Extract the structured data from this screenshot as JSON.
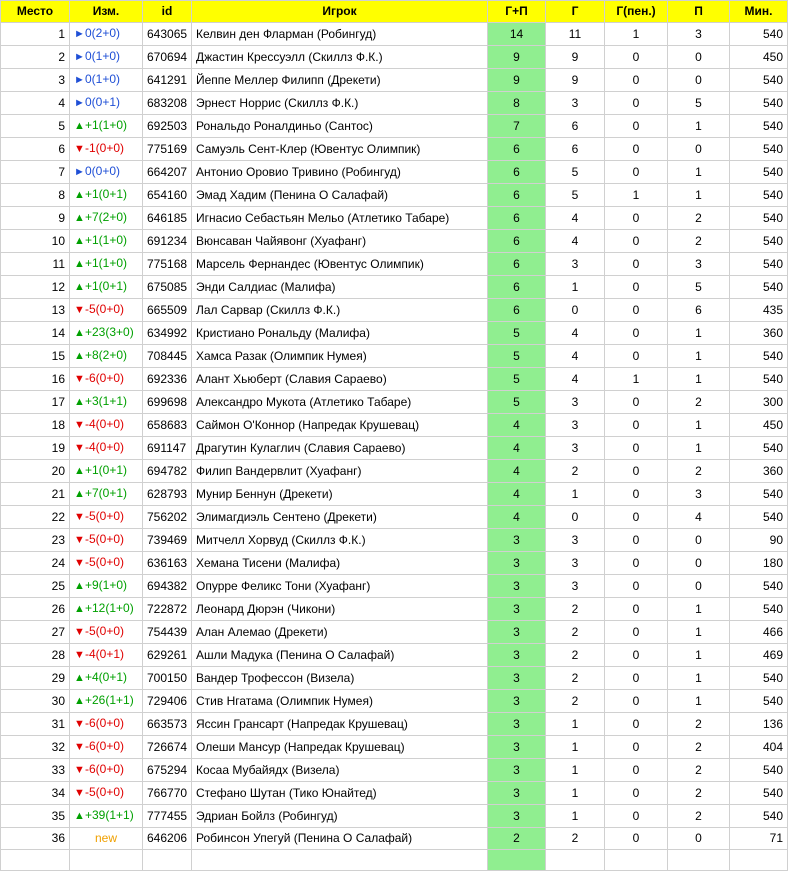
{
  "headers": [
    "Место",
    "Изм.",
    "id",
    "Игрок",
    "Г+П",
    "Г",
    "Г(пен.)",
    "П",
    "Мин."
  ],
  "colors": {
    "header_bg": "#ffff00",
    "gp_bg": "#90ee90",
    "up": "#00a000",
    "down": "#e00000",
    "same": "#1f4fd6",
    "new": "#f0a000"
  },
  "rows": [
    {
      "place": "1",
      "dir": "same",
      "change": "0(2+0)",
      "id": "643065",
      "player": "Келвин ден Фларман (Робингуд)",
      "gp": "14",
      "g": "11",
      "gpen": "1",
      "a": "3",
      "min": "540"
    },
    {
      "place": "2",
      "dir": "same",
      "change": "0(1+0)",
      "id": "670694",
      "player": "Джастин Крессуэлл (Скиллз Ф.К.)",
      "gp": "9",
      "g": "9",
      "gpen": "0",
      "a": "0",
      "min": "450"
    },
    {
      "place": "3",
      "dir": "same",
      "change": "0(1+0)",
      "id": "641291",
      "player": "Йеппе Меллер Филипп (Дрекети)",
      "gp": "9",
      "g": "9",
      "gpen": "0",
      "a": "0",
      "min": "540"
    },
    {
      "place": "4",
      "dir": "same",
      "change": "0(0+1)",
      "id": "683208",
      "player": "Эрнест Норрис (Скиллз Ф.К.)",
      "gp": "8",
      "g": "3",
      "gpen": "0",
      "a": "5",
      "min": "540"
    },
    {
      "place": "5",
      "dir": "up",
      "change": "+1(1+0)",
      "id": "692503",
      "player": "Рональдо Роналдиньо (Сантос)",
      "gp": "7",
      "g": "6",
      "gpen": "0",
      "a": "1",
      "min": "540"
    },
    {
      "place": "6",
      "dir": "down",
      "change": "-1(0+0)",
      "id": "775169",
      "player": "Самуэль Сент-Клер (Ювентус Олимпик)",
      "gp": "6",
      "g": "6",
      "gpen": "0",
      "a": "0",
      "min": "540"
    },
    {
      "place": "7",
      "dir": "same",
      "change": "0(0+0)",
      "id": "664207",
      "player": "Антонио Оровио Тривино (Робингуд)",
      "gp": "6",
      "g": "5",
      "gpen": "0",
      "a": "1",
      "min": "540"
    },
    {
      "place": "8",
      "dir": "up",
      "change": "+1(0+1)",
      "id": "654160",
      "player": "Эмад Хадим (Пенина О Салафай)",
      "gp": "6",
      "g": "5",
      "gpen": "1",
      "a": "1",
      "min": "540"
    },
    {
      "place": "9",
      "dir": "up",
      "change": "+7(2+0)",
      "id": "646185",
      "player": "Игнасио Себастьян Мельо (Атлетико Табаре)",
      "gp": "6",
      "g": "4",
      "gpen": "0",
      "a": "2",
      "min": "540"
    },
    {
      "place": "10",
      "dir": "up",
      "change": "+1(1+0)",
      "id": "691234",
      "player": "Вюнсаван Чайявонг (Хуафанг)",
      "gp": "6",
      "g": "4",
      "gpen": "0",
      "a": "2",
      "min": "540"
    },
    {
      "place": "11",
      "dir": "up",
      "change": "+1(1+0)",
      "id": "775168",
      "player": "Марсель Фернандес (Ювентус Олимпик)",
      "gp": "6",
      "g": "3",
      "gpen": "0",
      "a": "3",
      "min": "540"
    },
    {
      "place": "12",
      "dir": "up",
      "change": "+1(0+1)",
      "id": "675085",
      "player": "Энди Салдиас (Малифа)",
      "gp": "6",
      "g": "1",
      "gpen": "0",
      "a": "5",
      "min": "540"
    },
    {
      "place": "13",
      "dir": "down",
      "change": "-5(0+0)",
      "id": "665509",
      "player": "Лал Сарвар (Скиллз Ф.К.)",
      "gp": "6",
      "g": "0",
      "gpen": "0",
      "a": "6",
      "min": "435"
    },
    {
      "place": "14",
      "dir": "up",
      "change": "+23(3+0)",
      "id": "634992",
      "player": "Кристиано Рональду (Малифа)",
      "gp": "5",
      "g": "4",
      "gpen": "0",
      "a": "1",
      "min": "360"
    },
    {
      "place": "15",
      "dir": "up",
      "change": "+8(2+0)",
      "id": "708445",
      "player": "Хамса Разак (Олимпик Нумея)",
      "gp": "5",
      "g": "4",
      "gpen": "0",
      "a": "1",
      "min": "540"
    },
    {
      "place": "16",
      "dir": "down",
      "change": "-6(0+0)",
      "id": "692336",
      "player": "Алант Хьюберт (Славия Сараево)",
      "gp": "5",
      "g": "4",
      "gpen": "1",
      "a": "1",
      "min": "540"
    },
    {
      "place": "17",
      "dir": "up",
      "change": "+3(1+1)",
      "id": "699698",
      "player": "Александро Мукота (Атлетико Табаре)",
      "gp": "5",
      "g": "3",
      "gpen": "0",
      "a": "2",
      "min": "300"
    },
    {
      "place": "18",
      "dir": "down",
      "change": "-4(0+0)",
      "id": "658683",
      "player": "Саймон О'Коннор (Напредак Крушевац)",
      "gp": "4",
      "g": "3",
      "gpen": "0",
      "a": "1",
      "min": "450"
    },
    {
      "place": "19",
      "dir": "down",
      "change": "-4(0+0)",
      "id": "691147",
      "player": "Драгутин Кулаглич (Славия Сараево)",
      "gp": "4",
      "g": "3",
      "gpen": "0",
      "a": "1",
      "min": "540"
    },
    {
      "place": "20",
      "dir": "up",
      "change": "+1(0+1)",
      "id": "694782",
      "player": "Филип Вандервлит (Хуафанг)",
      "gp": "4",
      "g": "2",
      "gpen": "0",
      "a": "2",
      "min": "360"
    },
    {
      "place": "21",
      "dir": "up",
      "change": "+7(0+1)",
      "id": "628793",
      "player": "Мунир Беннун (Дрекети)",
      "gp": "4",
      "g": "1",
      "gpen": "0",
      "a": "3",
      "min": "540"
    },
    {
      "place": "22",
      "dir": "down",
      "change": "-5(0+0)",
      "id": "756202",
      "player": "Элимагдиэль Сентено (Дрекети)",
      "gp": "4",
      "g": "0",
      "gpen": "0",
      "a": "4",
      "min": "540"
    },
    {
      "place": "23",
      "dir": "down",
      "change": "-5(0+0)",
      "id": "739469",
      "player": "Митчелл Хорвуд (Скиллз Ф.К.)",
      "gp": "3",
      "g": "3",
      "gpen": "0",
      "a": "0",
      "min": "90"
    },
    {
      "place": "24",
      "dir": "down",
      "change": "-5(0+0)",
      "id": "636163",
      "player": "Хемана Тисени (Малифа)",
      "gp": "3",
      "g": "3",
      "gpen": "0",
      "a": "0",
      "min": "180"
    },
    {
      "place": "25",
      "dir": "up",
      "change": "+9(1+0)",
      "id": "694382",
      "player": "Опурре Феликс Тони (Хуафанг)",
      "gp": "3",
      "g": "3",
      "gpen": "0",
      "a": "0",
      "min": "540"
    },
    {
      "place": "26",
      "dir": "up",
      "change": "+12(1+0)",
      "id": "722872",
      "player": "Леонард Дюрэн (Чикони)",
      "gp": "3",
      "g": "2",
      "gpen": "0",
      "a": "1",
      "min": "540"
    },
    {
      "place": "27",
      "dir": "down",
      "change": "-5(0+0)",
      "id": "754439",
      "player": "Алан Алемао (Дрекети)",
      "gp": "3",
      "g": "2",
      "gpen": "0",
      "a": "1",
      "min": "466"
    },
    {
      "place": "28",
      "dir": "down",
      "change": "-4(0+1)",
      "id": "629261",
      "player": "Ашли Мадука (Пенина О Салафай)",
      "gp": "3",
      "g": "2",
      "gpen": "0",
      "a": "1",
      "min": "469"
    },
    {
      "place": "29",
      "dir": "up",
      "change": "+4(0+1)",
      "id": "700150",
      "player": "Вандер Трофессон (Визела)",
      "gp": "3",
      "g": "2",
      "gpen": "0",
      "a": "1",
      "min": "540"
    },
    {
      "place": "30",
      "dir": "up",
      "change": "+26(1+1)",
      "id": "729406",
      "player": "Стив Нгатама (Олимпик Нумея)",
      "gp": "3",
      "g": "2",
      "gpen": "0",
      "a": "1",
      "min": "540"
    },
    {
      "place": "31",
      "dir": "down",
      "change": "-6(0+0)",
      "id": "663573",
      "player": "Яссин Грансарт (Напредак Крушевац)",
      "gp": "3",
      "g": "1",
      "gpen": "0",
      "a": "2",
      "min": "136"
    },
    {
      "place": "32",
      "dir": "down",
      "change": "-6(0+0)",
      "id": "726674",
      "player": "Олеши Мансур (Напредак Крушевац)",
      "gp": "3",
      "g": "1",
      "gpen": "0",
      "a": "2",
      "min": "404"
    },
    {
      "place": "33",
      "dir": "down",
      "change": "-6(0+0)",
      "id": "675294",
      "player": "Косаа Мубайядх (Визела)",
      "gp": "3",
      "g": "1",
      "gpen": "0",
      "a": "2",
      "min": "540"
    },
    {
      "place": "34",
      "dir": "down",
      "change": "-5(0+0)",
      "id": "766770",
      "player": "Стефано Шутан (Тико Юнайтед)",
      "gp": "3",
      "g": "1",
      "gpen": "0",
      "a": "2",
      "min": "540"
    },
    {
      "place": "35",
      "dir": "up",
      "change": "+39(1+1)",
      "id": "777455",
      "player": "Эдриан Бойлз (Робингуд)",
      "gp": "3",
      "g": "1",
      "gpen": "0",
      "a": "2",
      "min": "540"
    },
    {
      "place": "36",
      "dir": "new",
      "change": "new",
      "id": "646206",
      "player": "Робинсон Упегуй (Пенина О Салафай)",
      "gp": "2",
      "g": "2",
      "gpen": "0",
      "a": "0",
      "min": "71"
    },
    {
      "place": "",
      "dir": "",
      "change": "",
      "id": "",
      "player": "",
      "gp": "",
      "g": "",
      "gpen": "",
      "a": "",
      "min": ""
    }
  ]
}
